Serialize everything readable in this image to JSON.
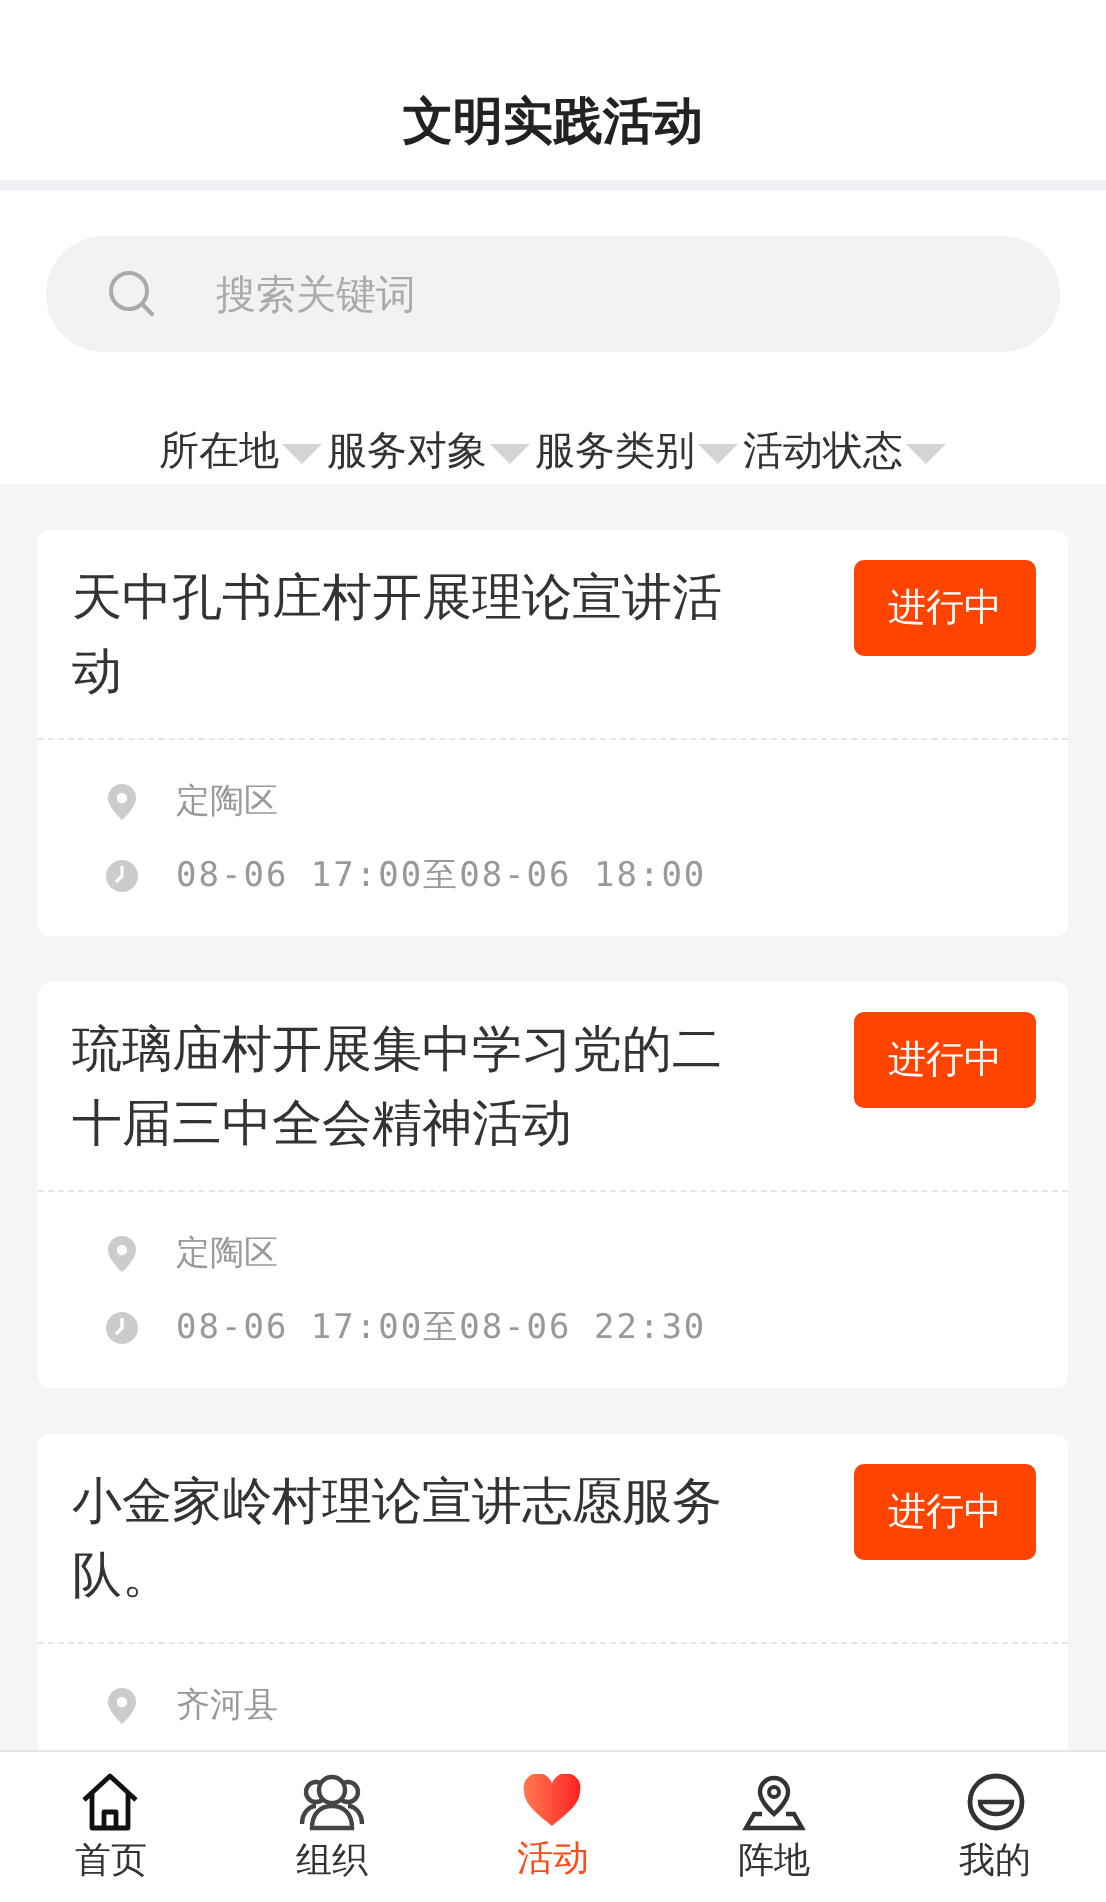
{
  "header": {
    "title": "文明实践活动"
  },
  "search": {
    "placeholder": "搜索关键词"
  },
  "filters": [
    "所在地",
    "服务对象",
    "服务类别",
    "活动状态"
  ],
  "activities": [
    {
      "title": "天中孔书庄村开展理论宣讲活动",
      "status": "进行中",
      "location": "定陶区",
      "time": "08-06  17:00至08-06  18:00"
    },
    {
      "title": "琉璃庙村开展集中学习党的二十届三中全会精神活动",
      "status": "进行中",
      "location": "定陶区",
      "time": "08-06  17:00至08-06  22:30"
    },
    {
      "title": "小金家岭村理论宣讲志愿服务队。",
      "status": "进行中",
      "location": "齐河县"
    }
  ],
  "tabbar": [
    {
      "label": "首页",
      "kind": "home",
      "selected": false
    },
    {
      "label": "组织",
      "kind": "people",
      "selected": false
    },
    {
      "label": "活动",
      "kind": "heart",
      "selected": true
    },
    {
      "label": "阵地",
      "kind": "pin",
      "selected": false
    },
    {
      "label": "我的",
      "kind": "smile",
      "selected": false
    }
  ]
}
